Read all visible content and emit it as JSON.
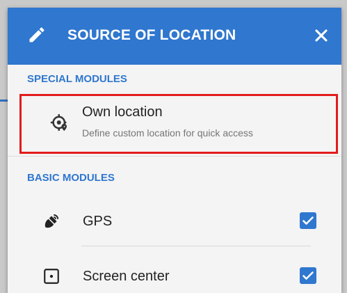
{
  "header": {
    "title": "SOURCE OF LOCATION"
  },
  "sections": {
    "special": "SPECIAL MODULES",
    "basic": "BASIC MODULES"
  },
  "own_location": {
    "title": "Own location",
    "subtitle": "Define custom location for quick access"
  },
  "modules": [
    {
      "label": "GPS",
      "checked": true
    },
    {
      "label": "Screen center",
      "checked": true
    }
  ],
  "colors": {
    "accent": "#2f77cf",
    "highlight": "#e21b1b"
  },
  "icons": [
    "edit-icon",
    "close-icon",
    "own-location-icon",
    "gps-icon",
    "screen-center-icon",
    "checkbox-icon"
  ]
}
